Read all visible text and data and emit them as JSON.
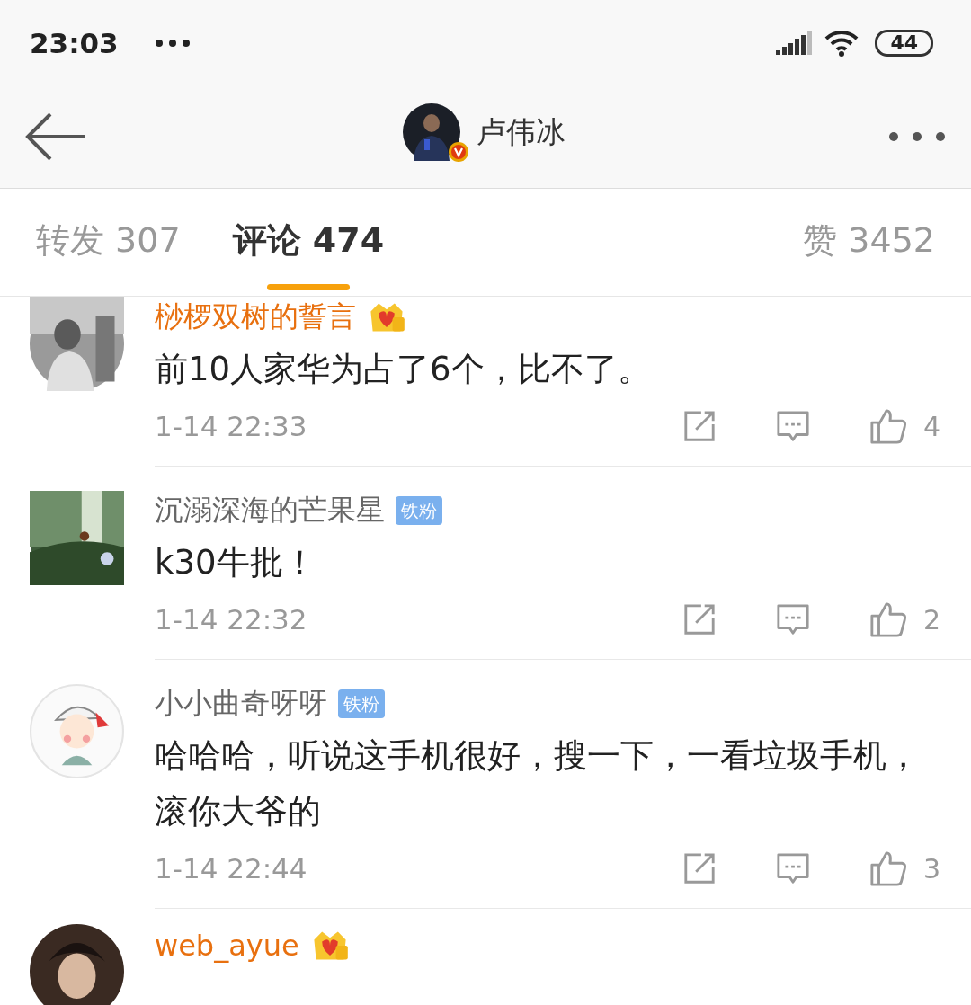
{
  "status_bar": {
    "time": "23:03",
    "battery": "44"
  },
  "header": {
    "title": "卢伟冰",
    "verified": true
  },
  "tabs": [
    {
      "label": "转发 307",
      "selected": false
    },
    {
      "label": "评论 474",
      "selected": true
    },
    {
      "label": "赞 3452",
      "selected": false
    }
  ],
  "comments": [
    {
      "name": "桫椤双树的誓言",
      "member": true,
      "text": "前10人家华为占了6个，比不了。",
      "time": "1-14 22:33",
      "likes": "4"
    },
    {
      "name": "沉溺深海的芒果星",
      "member": false,
      "badge": "铁粉",
      "text": "k30牛批！",
      "time": "1-14 22:32",
      "likes": "2"
    },
    {
      "name": "小小曲奇呀呀",
      "member": false,
      "badge": "铁粉",
      "text": "哈哈哈，听说这手机很好，搜一下，一看垃圾手机，滚你大爷的",
      "time": "1-14 22:44",
      "likes": "3"
    }
  ],
  "partial_comment": {
    "name": "web_ayue",
    "member": true
  }
}
